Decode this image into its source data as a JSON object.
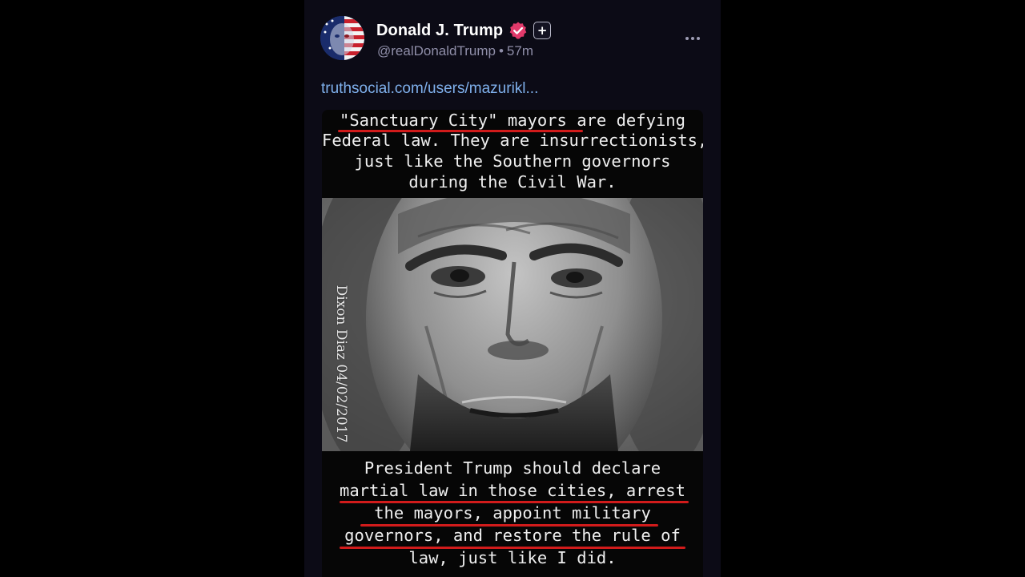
{
  "post": {
    "author": {
      "display_name": "Donald J. Trump",
      "handle": "@realDonaldTrump",
      "timestamp": "57m",
      "separator": "•",
      "verified_icon": "verified-badge-icon",
      "plus_icon": "plus-badge-icon",
      "plus_glyph": "+"
    },
    "more_icon": "more-dots-icon",
    "link_text": "truthsocial.com/users/mazurikl...",
    "meme": {
      "top_lines": [
        "\"Sanctuary City\" mayors are defying",
        "Federal law. They are insurrectionists,",
        "just like the Southern governors",
        "during the Civil War."
      ],
      "watermark": "Dixon Diaz 04/02/2017",
      "bottom_lines": [
        "President Trump should declare",
        "martial law in those cities, arrest",
        "the mayors, appoint military",
        "governors, and restore the rule of",
        "law, just like I did."
      ]
    }
  },
  "colors": {
    "background": "#000000",
    "panel": "#0c0b16",
    "link": "#7fb0ec",
    "meta_text": "#8f8ea8",
    "verified_badge": "#e23a6b",
    "underline": "#d11b1b"
  }
}
